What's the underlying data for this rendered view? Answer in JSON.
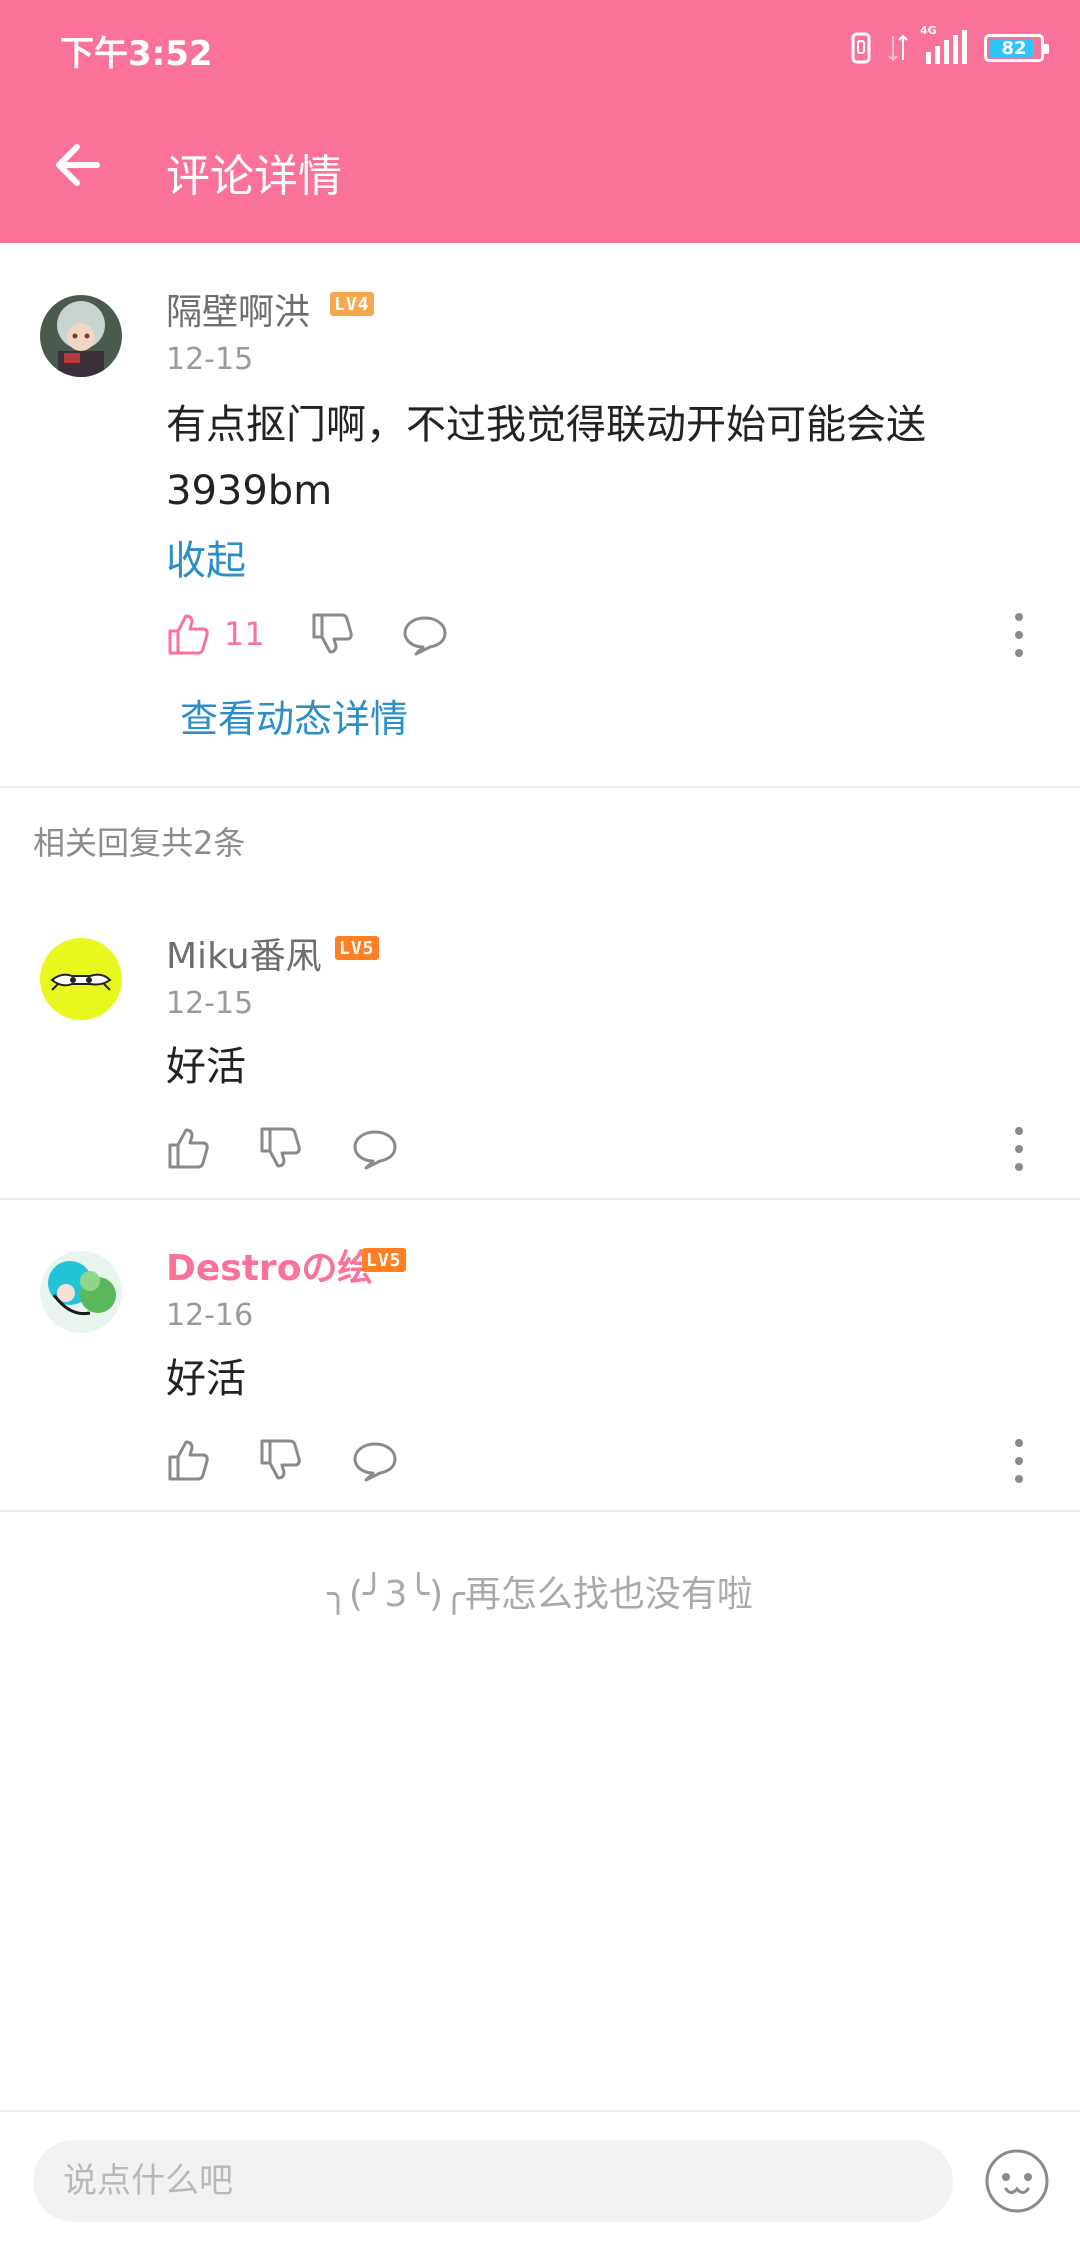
{
  "status_bar": {
    "time": "下午3:52",
    "network": "4G",
    "battery": "82"
  },
  "app_bar": {
    "title": "评论详情"
  },
  "main_comment": {
    "username": "隔壁啊洪",
    "level": "LV4",
    "date": "12-15",
    "content_line1": "有点抠门啊，不过我觉得联动开始可能会送",
    "content_line2": "3939bm",
    "collapse_label": "收起",
    "like_count": "11",
    "view_dynamic_label": "查看动态详情"
  },
  "replies_header": "相关回复共2条",
  "replies": [
    {
      "username": "Miku番凩",
      "level": "LV5",
      "date": "12-15",
      "content": "好活"
    },
    {
      "username": "Destroの绘",
      "level": "LV5",
      "date": "12-16",
      "content": "好活"
    }
  ],
  "end_message": "╮(╯3╰)╭再怎么找也没有啦",
  "input": {
    "placeholder": "说点什么吧"
  },
  "colors": {
    "brand": "#fb7299",
    "link": "#2b8fc6",
    "level4": "#f5a84e",
    "level5": "#ff7f24"
  }
}
